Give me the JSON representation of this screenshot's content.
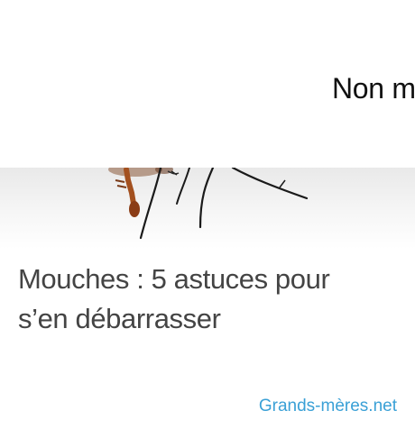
{
  "top_heading": "Non m",
  "card": {
    "image_alt": "fly-photo",
    "title_line1": "Mouches : 5 astuces pour",
    "title_line2": "s’en débarrasser",
    "source": "Grands-mères.net"
  },
  "colors": {
    "source_link": "#3aa0d6",
    "title_text": "#444444",
    "heading_text": "#111111"
  }
}
